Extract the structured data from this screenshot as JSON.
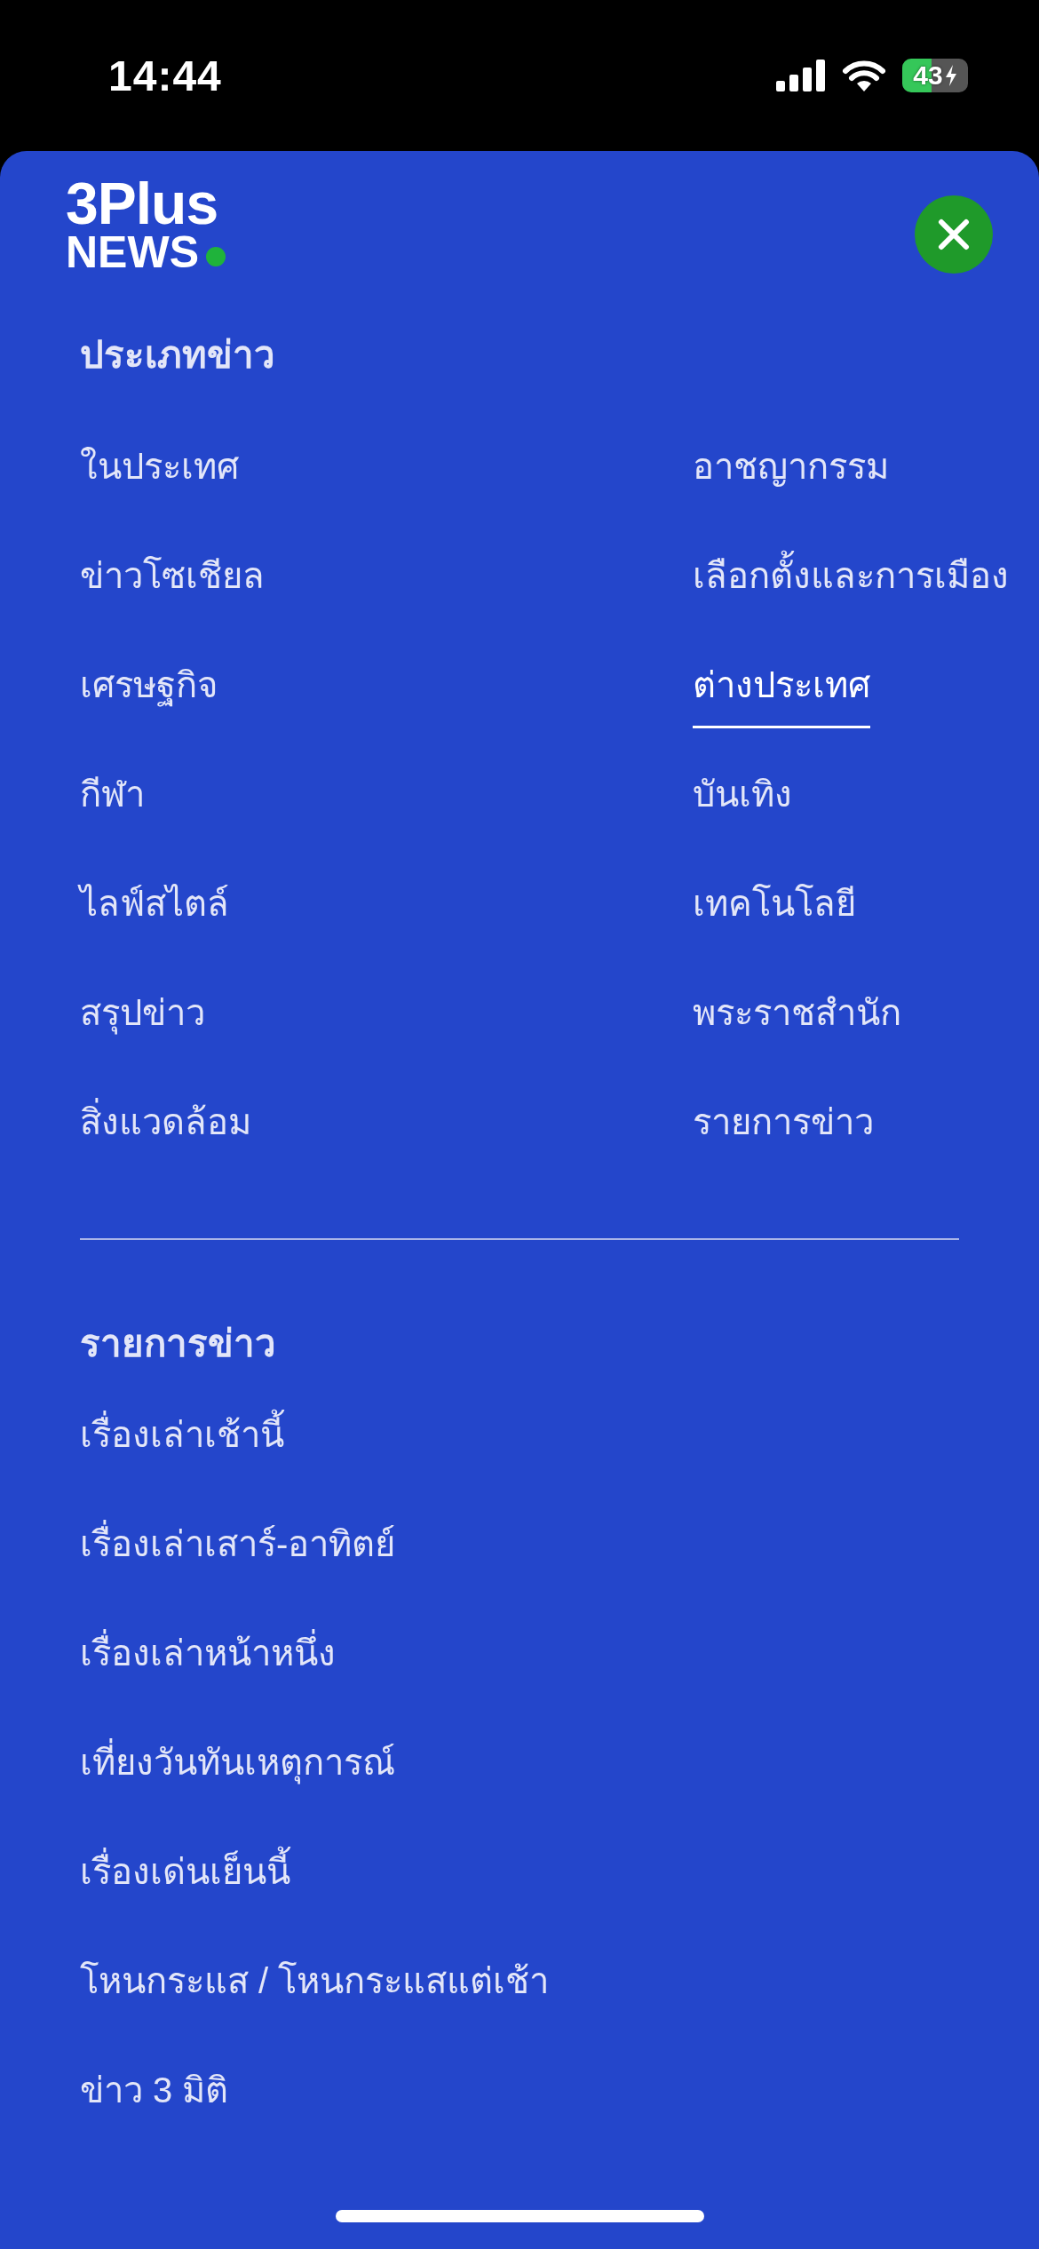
{
  "status_bar": {
    "time": "14:44",
    "battery": "43"
  },
  "logo": {
    "line_1": "3Plus",
    "line_2": "NEWS"
  },
  "sections": [
    {
      "title": "ประเภทข่าว",
      "kind": "grid",
      "items": [
        {
          "label": "ในประเทศ",
          "selected": false
        },
        {
          "label": "อาชญากรรม",
          "selected": false
        },
        {
          "label": "ข่าวโซเชียล",
          "selected": false
        },
        {
          "label": "เลือกตั้งและการเมือง",
          "selected": false
        },
        {
          "label": "เศรษฐกิจ",
          "selected": false
        },
        {
          "label": "ต่างประเทศ",
          "selected": true
        },
        {
          "label": "กีฬา",
          "selected": false
        },
        {
          "label": "บันเทิง",
          "selected": false
        },
        {
          "label": "ไลฟ์สไตล์",
          "selected": false
        },
        {
          "label": "เทคโนโลยี",
          "selected": false
        },
        {
          "label": "สรุปข่าว",
          "selected": false
        },
        {
          "label": "พระราชสำนัก",
          "selected": false
        },
        {
          "label": "สิ่งแวดล้อม",
          "selected": false
        },
        {
          "label": "รายการข่าว",
          "selected": false
        }
      ]
    },
    {
      "title": "รายการข่าว",
      "kind": "list",
      "items": [
        {
          "label": "เรื่องเล่าเช้านี้",
          "selected": false
        },
        {
          "label": "เรื่องเล่าเสาร์-อาทิตย์",
          "selected": false
        },
        {
          "label": "เรื่องเล่าหน้าหนึ่ง",
          "selected": false
        },
        {
          "label": "เที่ยงวันทันเหตุการณ์",
          "selected": false
        },
        {
          "label": "เรื่องเด่นเย็นนี้",
          "selected": false
        },
        {
          "label": "โหนกระแส / โหนกระแสแต่เช้า",
          "selected": false
        },
        {
          "label": "ข่าว 3 มิติ",
          "selected": false
        }
      ]
    }
  ]
}
